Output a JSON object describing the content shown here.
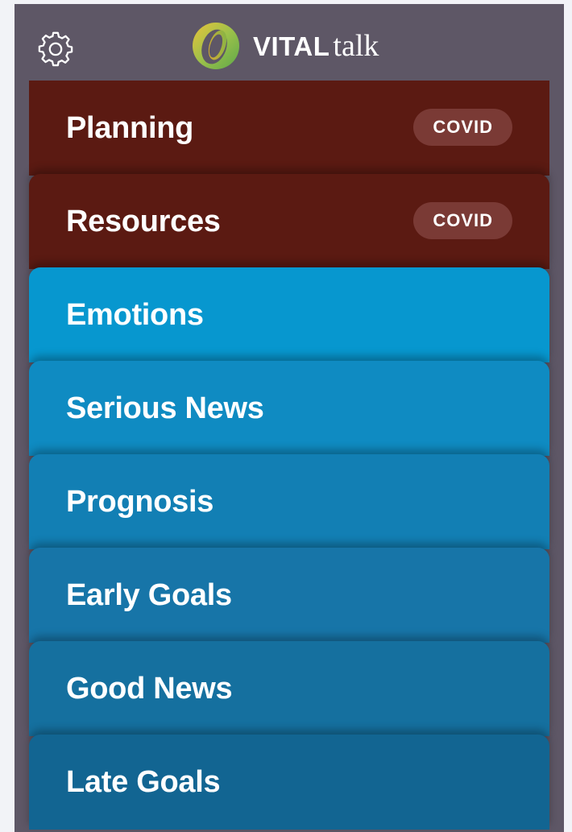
{
  "header": {
    "settings_icon": "gear-icon",
    "logo_icon": "vitaltalk-logo-ring",
    "logo_bold": "VITAL",
    "logo_light": "talk"
  },
  "cards": [
    {
      "label": "Planning",
      "badge": "COVID",
      "color": "#5b1a12"
    },
    {
      "label": "Resources",
      "badge": "COVID",
      "color": "#5b1a12"
    },
    {
      "label": "Emotions",
      "badge": "",
      "color": "#0797cf"
    },
    {
      "label": "Serious News",
      "badge": "",
      "color": "#0f8bc2"
    },
    {
      "label": "Prognosis",
      "badge": "",
      "color": "#127fb4"
    },
    {
      "label": "Early Goals",
      "badge": "",
      "color": "#1775a8"
    },
    {
      "label": "Good News",
      "badge": "",
      "color": "#15709f"
    },
    {
      "label": "Late Goals",
      "badge": "",
      "color": "#126592"
    }
  ],
  "colors": {
    "frame": "#5e5766",
    "covid_badge_bg": "#7a3a35",
    "logo_green": "#7ab648",
    "logo_yellow": "#e9b536"
  }
}
